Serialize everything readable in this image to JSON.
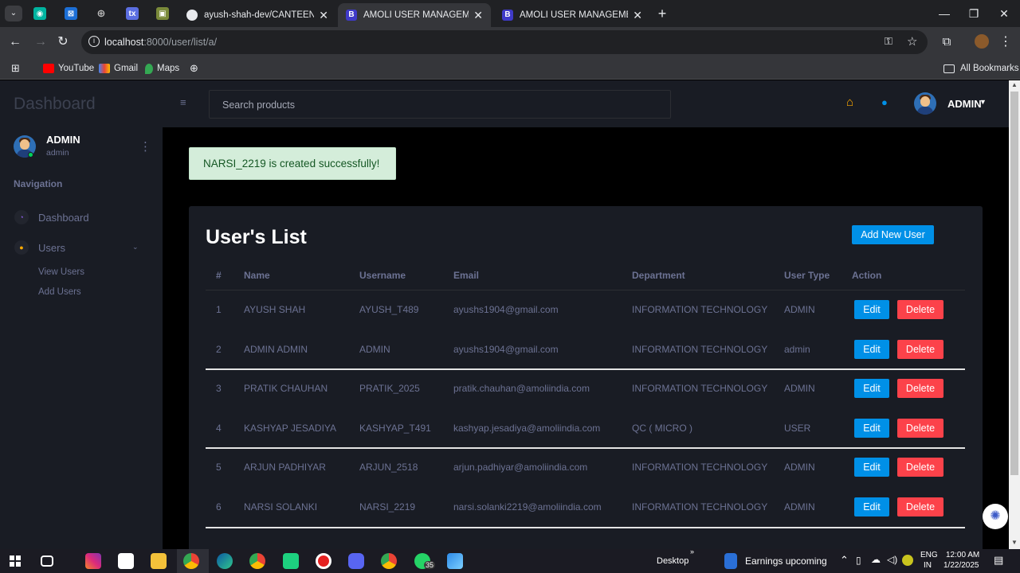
{
  "browser": {
    "tabs": [
      {
        "title": "ayush-shah-dev/CANTEEN_MA",
        "active": false
      },
      {
        "title": "AMOLI USER MANAGEMENT SY",
        "active": true
      },
      {
        "title": "AMOLI USER MANAGEMENT SY",
        "active": false
      }
    ],
    "url_host": "localhost",
    "url_rest": ":8000/user/list/a/",
    "bookmarks": [
      "YouTube",
      "Gmail",
      "Maps"
    ],
    "all_bookmarks": "All Bookmarks"
  },
  "sidebar": {
    "brand": "Dashboard",
    "user_name": "ADMIN",
    "user_role": "admin",
    "nav_heading": "Navigation",
    "items": [
      {
        "label": "Dashboard"
      },
      {
        "label": "Users"
      }
    ],
    "sub_items": [
      "View Users",
      "Add Users"
    ]
  },
  "topnav": {
    "search_placeholder": "Search products",
    "user_label": "ADMIN"
  },
  "alert": {
    "message": "NARSI_2219 is created successfully!"
  },
  "users_card": {
    "title": "User's List",
    "add_button": "Add New User",
    "columns": [
      "#",
      "Name",
      "Username",
      "Email",
      "Department",
      "User Type",
      "Action"
    ],
    "edit_label": "Edit",
    "delete_label": "Delete",
    "rows": [
      {
        "num": "1",
        "name": "AYUSH SHAH",
        "username": "AYUSH_T489",
        "email": "ayushs1904@gmail.com",
        "department": "INFORMATION TECHNOLOGY",
        "type": "ADMIN"
      },
      {
        "num": "2",
        "name": "ADMIN ADMIN",
        "username": "ADMIN",
        "email": "ayushs1904@gmail.com",
        "department": "INFORMATION TECHNOLOGY",
        "type": "admin"
      },
      {
        "num": "3",
        "name": "PRATIK CHAUHAN",
        "username": "PRATIK_2025",
        "email": "pratik.chauhan@amoliindia.com",
        "department": "INFORMATION TECHNOLOGY",
        "type": "ADMIN"
      },
      {
        "num": "4",
        "name": "KASHYAP JESADIYA",
        "username": "KASHYAP_T491",
        "email": "kashyap.jesadiya@amoliindia.com",
        "department": "QC ( MICRO )",
        "type": "USER"
      },
      {
        "num": "5",
        "name": "ARJUN PADHIYAR",
        "username": "ARJUN_2518",
        "email": "arjun.padhiyar@amoliindia.com",
        "department": "INFORMATION TECHNOLOGY",
        "type": "ADMIN"
      },
      {
        "num": "6",
        "name": "NARSI SOLANKI",
        "username": "NARSI_2219",
        "email": "narsi.solanki2219@amoliindia.com",
        "department": "INFORMATION TECHNOLOGY",
        "type": "ADMIN"
      }
    ]
  },
  "taskbar": {
    "desktop_label": "Desktop",
    "weather_label": "Earnings upcoming",
    "badge_count": "35",
    "lang_line1": "ENG",
    "lang_line2": "IN",
    "time": "12:00 AM",
    "date": "1/22/2025"
  },
  "colors": {
    "sidebar_bg": "#191c24",
    "primary": "#0090e7",
    "danger": "#fc424a",
    "accent_orange": "#ffab00",
    "success_bg": "#d4edda"
  }
}
